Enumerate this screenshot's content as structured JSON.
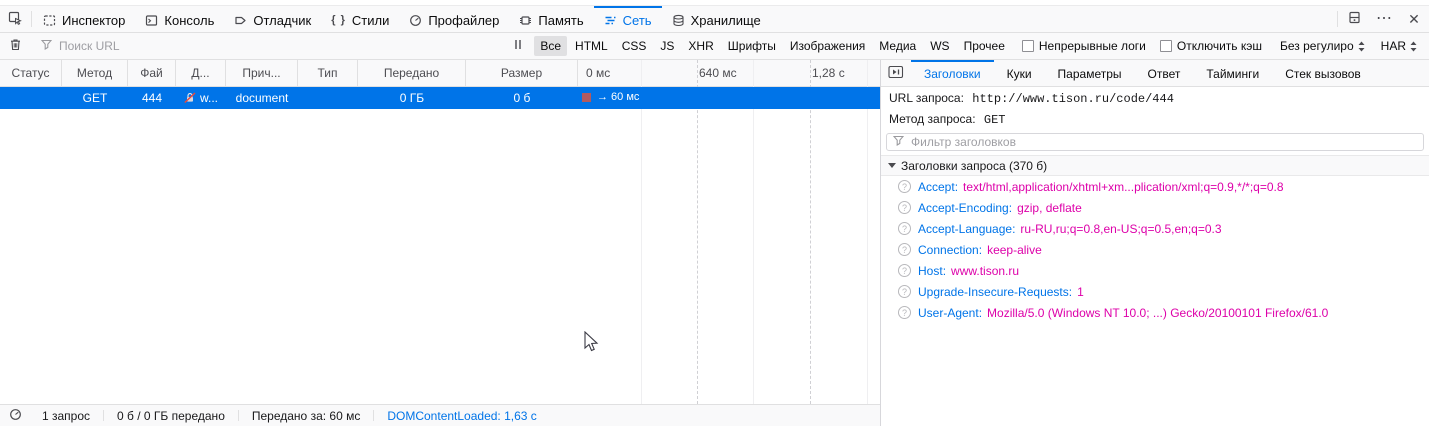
{
  "toolbox": {
    "tabs": [
      {
        "label": "Инспектор"
      },
      {
        "label": "Консоль"
      },
      {
        "label": "Отладчик"
      },
      {
        "label": "Стили"
      },
      {
        "label": "Профайлер"
      },
      {
        "label": "Память"
      },
      {
        "label": "Сеть"
      },
      {
        "label": "Хранилище"
      }
    ],
    "icons": {
      "styles_glyph": "{ }",
      "menu_glyph": "⋯",
      "close_glyph": "✕"
    }
  },
  "net_toolbar": {
    "search_placeholder": "Поиск URL",
    "filters": [
      "Все",
      "HTML",
      "CSS",
      "JS",
      "XHR",
      "Шрифты",
      "Изображения",
      "Медиа",
      "WS",
      "Прочее"
    ],
    "active_filter": "Все",
    "checkboxes": [
      {
        "label": "Непрерывные логи",
        "checked": false
      },
      {
        "label": "Отключить кэш",
        "checked": false
      }
    ],
    "throttling_label": "Без регулиро",
    "har_label": "HAR"
  },
  "request_list": {
    "columns": [
      "Статус",
      "Метод",
      "Фай",
      "Д...",
      "Прич...",
      "Тип",
      "Передано",
      "Размер"
    ],
    "timeline_ticks": [
      "0 мс",
      "640 мс",
      "1,28 с"
    ],
    "row": {
      "status": "",
      "method": "GET",
      "file": "444",
      "domain": "w...",
      "cause": "document",
      "type": "",
      "transferred": "0 ГБ",
      "size": "0 б",
      "waterfall": "→ 60 мс"
    }
  },
  "details": {
    "tabs": [
      "Заголовки",
      "Куки",
      "Параметры",
      "Ответ",
      "Тайминги",
      "Стек вызовов"
    ],
    "active_tab": "Заголовки",
    "url_label": "URL запроса:",
    "url_value": "http://www.tison.ru/code/444",
    "method_label": "Метод запроса:",
    "method_value": "GET",
    "filter_placeholder": "Фильтр заголовков",
    "request_headers_title": "Заголовки запроса (370 б)",
    "headers": [
      {
        "name": "Accept",
        "value": "text/html,application/xhtml+xm...plication/xml;q=0.9,*/*;q=0.8"
      },
      {
        "name": "Accept-Encoding",
        "value": "gzip, deflate"
      },
      {
        "name": "Accept-Language",
        "value": "ru-RU,ru;q=0.8,en-US;q=0.5,en;q=0.3"
      },
      {
        "name": "Connection",
        "value": "keep-alive"
      },
      {
        "name": "Host",
        "value": "www.tison.ru"
      },
      {
        "name": "Upgrade-Insecure-Requests",
        "value": "1"
      },
      {
        "name": "User-Agent",
        "value": "Mozilla/5.0 (Windows NT 10.0; ...) Gecko/20100101 Firefox/61.0"
      }
    ]
  },
  "status_bar": {
    "requests": "1 запрос",
    "transferred": "0 б / 0 ГБ передано",
    "finish": "Передано за: 60 мс",
    "dom_content_loaded": "DOMContentLoaded: 1,63 с"
  },
  "colors": {
    "accent": "#0074e8",
    "selection_bg": "#0074e8",
    "header_name": "#0074e8",
    "header_value": "#dd00a9",
    "waterfall_block": "#b25a60",
    "toolbar_bg": "#f9f9fa"
  }
}
